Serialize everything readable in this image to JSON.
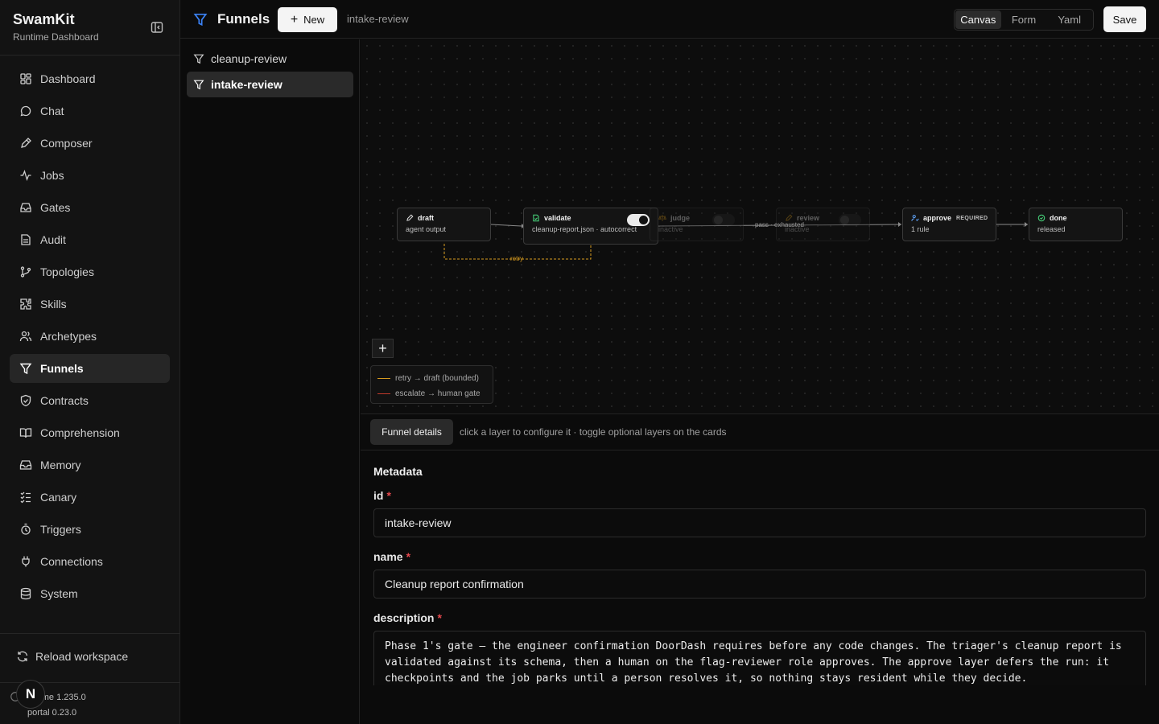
{
  "brand": {
    "title": "SwamKit",
    "subtitle": "Runtime Dashboard"
  },
  "sidebar": {
    "items": [
      {
        "label": "Dashboard",
        "icon": "dashboard-icon"
      },
      {
        "label": "Chat",
        "icon": "chat-icon"
      },
      {
        "label": "Composer",
        "icon": "composer-icon"
      },
      {
        "label": "Jobs",
        "icon": "jobs-icon"
      },
      {
        "label": "Gates",
        "icon": "gates-icon"
      },
      {
        "label": "Audit",
        "icon": "audit-icon"
      },
      {
        "label": "Topologies",
        "icon": "topologies-icon"
      },
      {
        "label": "Skills",
        "icon": "skills-icon"
      },
      {
        "label": "Archetypes",
        "icon": "archetypes-icon"
      },
      {
        "label": "Funnels",
        "icon": "funnel-icon",
        "active": true
      },
      {
        "label": "Contracts",
        "icon": "contracts-icon"
      },
      {
        "label": "Comprehension",
        "icon": "comprehension-icon"
      },
      {
        "label": "Memory",
        "icon": "memory-icon"
      },
      {
        "label": "Canary",
        "icon": "canary-icon"
      },
      {
        "label": "Triggers",
        "icon": "triggers-icon"
      },
      {
        "label": "Connections",
        "icon": "connections-icon"
      },
      {
        "label": "System",
        "icon": "system-icon"
      }
    ],
    "reload_label": "Reload workspace",
    "runtime_version": "untime 1.235.0",
    "portal_version": "portal 0.23.0",
    "avatar_initial": "N"
  },
  "topbar": {
    "title": "Funnels",
    "new_label": "New",
    "crumb": "intake-review",
    "view_modes": [
      "Canvas",
      "Form",
      "Yaml"
    ],
    "active_mode": "Canvas",
    "save_label": "Save"
  },
  "funnel_list": [
    {
      "label": "cleanup-review",
      "active": false
    },
    {
      "label": "intake-review",
      "active": true
    }
  ],
  "canvas": {
    "nodes": [
      {
        "title": "draft",
        "subtitle": "agent output",
        "icon": "pencil-icon"
      },
      {
        "title": "validate",
        "subtitle": "cleanup-report.json · autocorrect",
        "icon": "file-check-icon",
        "toggle": "on"
      },
      {
        "title": "judge",
        "subtitle": "inactive",
        "icon": "scale-icon",
        "toggle": "off"
      },
      {
        "title": "review",
        "subtitle": "inactive",
        "icon": "review-icon",
        "toggle": "off"
      },
      {
        "title": "approve",
        "subtitle": "1 rule",
        "badge": "REQUIRED",
        "icon": "user-check-icon"
      },
      {
        "title": "done",
        "subtitle": "released",
        "icon": "check-circle-icon"
      }
    ],
    "edge_label": "pass · exhausted",
    "retry_label": "retry",
    "legend": [
      {
        "label": "retry → draft (bounded)",
        "color": "#d69a1f",
        "style": "dashed"
      },
      {
        "label": "escalate → human gate",
        "color": "#c0392b",
        "style": "dashed"
      }
    ],
    "colors": {
      "retry": "#d69a1f",
      "escalate": "#c0392b",
      "edge": "#8a8a8a"
    }
  },
  "details": {
    "tab_label": "Funnel details",
    "hint": "click a layer to configure it · toggle optional layers on the cards",
    "section_title": "Metadata",
    "fields": {
      "id_label": "id",
      "id_value": "intake-review",
      "name_label": "name",
      "name_value": "Cleanup report confirmation",
      "description_label": "description",
      "description_value": "Phase 1's gate — the engineer confirmation DoorDash requires before any code changes. The triager's cleanup report is validated against its schema, then a human on the flag-reviewer role approves. The approve layer defers the run: it checkpoints and the job parks until a person resolves it, so nothing stays resident while they decide.",
      "required_mark": "*"
    }
  }
}
